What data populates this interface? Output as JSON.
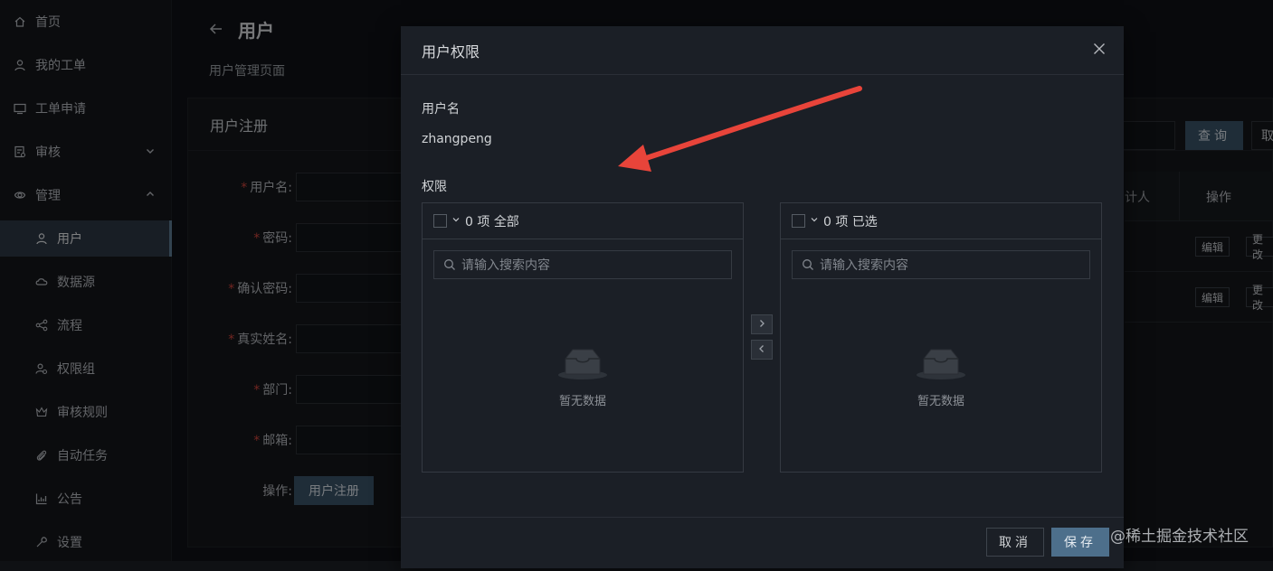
{
  "sidebar": {
    "items": [
      {
        "label": "首页",
        "icon": "home-icon"
      },
      {
        "label": "我的工单",
        "icon": "user-icon"
      },
      {
        "label": "工单申请",
        "icon": "monitor-icon"
      },
      {
        "label": "审核",
        "icon": "audit-icon"
      },
      {
        "label": "管理",
        "icon": "settings-cog-icon"
      }
    ],
    "sub_items": [
      {
        "label": "用户",
        "icon": "user-icon"
      },
      {
        "label": "数据源",
        "icon": "cloud-database-icon"
      },
      {
        "label": "流程",
        "icon": "flow-icon"
      },
      {
        "label": "权限组",
        "icon": "permission-group-icon"
      },
      {
        "label": "审核规则",
        "icon": "crown-icon"
      },
      {
        "label": "自动任务",
        "icon": "paperclip-icon"
      },
      {
        "label": "公告",
        "icon": "chart-icon"
      },
      {
        "label": "设置",
        "icon": "wrench-icon"
      }
    ]
  },
  "header": {
    "title": "用户",
    "subtitle": "用户管理页面"
  },
  "register_card": {
    "title": "用户注册",
    "fields": [
      {
        "label": "用户名:",
        "required": true
      },
      {
        "label": "密码:",
        "required": true
      },
      {
        "label": "确认密码:",
        "required": true
      },
      {
        "label": "真实姓名:",
        "required": true
      },
      {
        "label": "部门:",
        "required": true
      },
      {
        "label": "邮箱:",
        "required": true
      }
    ],
    "action_label": "操作:",
    "submit_label": "用户注册"
  },
  "right_panel": {
    "query_label": "查询",
    "cut_button_label": "取",
    "col_partial": "计人",
    "col_actions": "操作",
    "rows": [
      {
        "edit": "编辑",
        "change": "更改"
      },
      {
        "edit": "编辑",
        "change": "更改"
      }
    ]
  },
  "modal": {
    "title": "用户权限",
    "username_label": "用户名",
    "username_value": "zhangpeng",
    "permission_label": "权限",
    "left_list": {
      "count": "0 项",
      "title": "全部",
      "placeholder": "请输入搜索内容",
      "empty": "暂无数据"
    },
    "right_list": {
      "count": "0 项",
      "title": "已选",
      "placeholder": "请输入搜索内容",
      "empty": "暂无数据"
    },
    "cancel_label": "取消",
    "save_label": "保存"
  },
  "watermark": "@稀土掘金技术社区",
  "colors": {
    "accent": "#3a5266",
    "save": "#4d6f8b",
    "annotation_arrow": "#e8443a",
    "required": "#d0453d"
  }
}
